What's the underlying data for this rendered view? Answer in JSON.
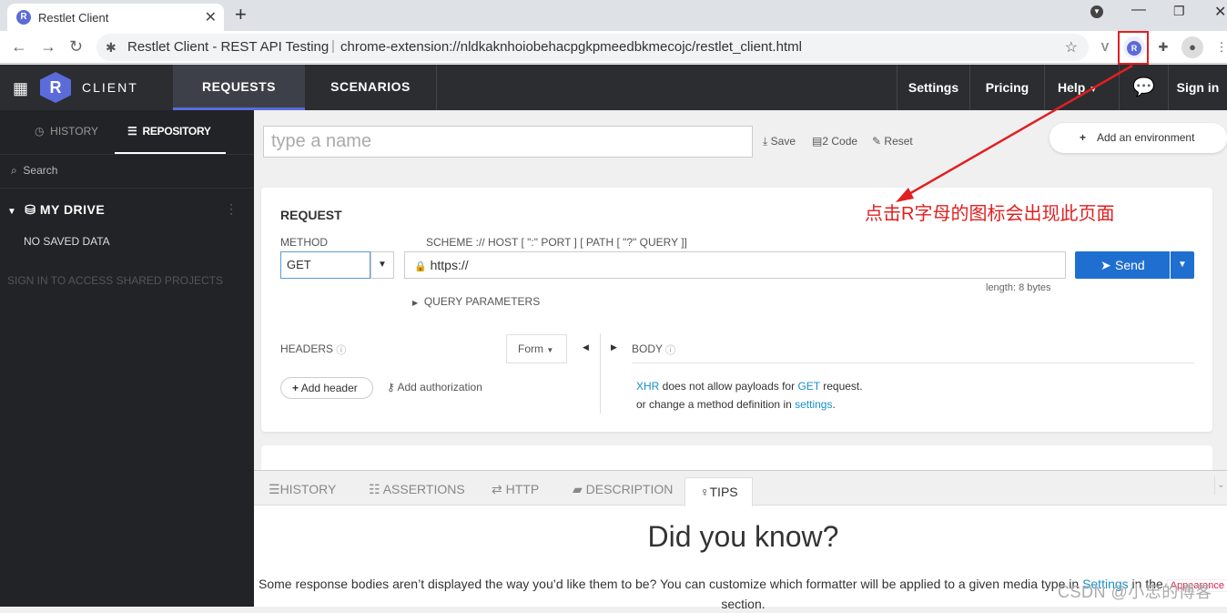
{
  "browser": {
    "tab_title": "Restlet Client",
    "tab_favicon": "R",
    "page_title": "Restlet Client - REST API Testing",
    "separator": "|",
    "url": "chrome-extension://nldkaknhoiobehacpgkpmeedbkmecojc/restlet_client.html",
    "extension_label": "R"
  },
  "app": {
    "logo_letter": "R",
    "logo_text": "CLIENT",
    "nav": {
      "requests": "REQUESTS",
      "scenarios": "SCENARIOS"
    },
    "header_links": {
      "settings": "Settings",
      "pricing": "Pricing",
      "help": "Help",
      "signin": "Sign in"
    }
  },
  "sidebar": {
    "history_tab": "HISTORY",
    "repository_tab": "REPOSITORY",
    "search_label": "Search",
    "drive_title": "MY DRIVE",
    "no_saved": "NO SAVED DATA",
    "sign_in_prompt": "SIGN IN TO ACCESS SHARED PROJECTS"
  },
  "toolbar": {
    "name_placeholder": "type a name",
    "save": "Save",
    "code": "2 Code",
    "reset": "Reset",
    "add_environment": "Add an environment"
  },
  "request": {
    "title": "REQUEST",
    "method_label": "METHOD",
    "method_value": "GET",
    "scheme_hint": "SCHEME :// HOST [ \":\" PORT ] [ PATH [ \"?\" QUERY ]]",
    "url_value": "https://",
    "length": "length: 8 bytes",
    "send": "Send",
    "query_params": "QUERY PARAMETERS",
    "headers_label": "HEADERS",
    "form_label": "Form",
    "add_header": "Add header",
    "add_authorization": "Add authorization",
    "body_label": "BODY",
    "body_msg_1_link": "XHR",
    "body_msg_1_mid": " does not allow payloads for ",
    "body_msg_1_link2": "GET",
    "body_msg_1_end": " request.",
    "body_msg_2_start": "or change a method definition in ",
    "body_msg_2_link": "settings",
    "body_msg_2_end": "."
  },
  "bottom": {
    "tabs": [
      "HISTORY",
      "ASSERTIONS",
      "HTTP",
      "DESCRIPTION",
      "TIPS"
    ],
    "heading": "Did you know?",
    "tip_start": "Some response bodies aren’t displayed the way you’d like them to be? You can customize which formatter will be applied to a given media type in ",
    "tip_link": "Settings",
    "tip_mid": " in the ",
    "tip_badge": "Appearance",
    "tip_end": "section."
  },
  "annotation": {
    "text": "点击R字母的图标会出现此页面",
    "color": "#e02020"
  },
  "watermark": "CSDN @小忠的博客",
  "colors": {
    "accent": "#5b6bd9",
    "send": "#1f6fd0",
    "link": "#1a8fc9",
    "dark": "#2b2d31"
  }
}
